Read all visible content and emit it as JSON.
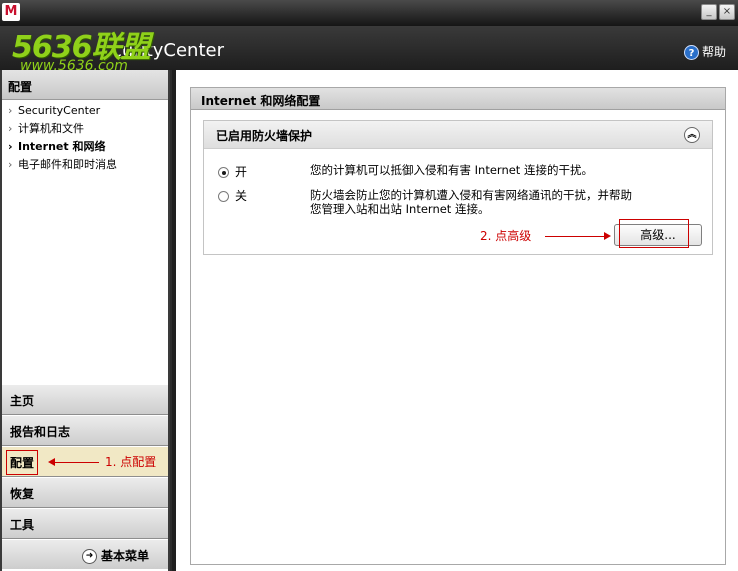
{
  "window": {
    "logo_letter": "M",
    "minimize": "_",
    "close": "×"
  },
  "header": {
    "watermark": "5636联盟",
    "watermark_url": "www.5636.com",
    "title_fragment": "curityCenter",
    "help_label": "帮助"
  },
  "sidebar": {
    "header": "配置",
    "items": [
      {
        "label": "SecurityCenter",
        "active": false
      },
      {
        "label": "计算机和文件",
        "active": false
      },
      {
        "label": "Internet 和网络",
        "active": true
      },
      {
        "label": "电子邮件和即时消息",
        "active": false
      }
    ],
    "tabs": [
      {
        "label": "主页"
      },
      {
        "label": "报告和日志"
      },
      {
        "label": "配置",
        "selected": true
      },
      {
        "label": "恢复"
      },
      {
        "label": "工具"
      }
    ],
    "basic_menu": "基本菜单",
    "annotation": "1. 点配置"
  },
  "main": {
    "frame_title": "Internet 和网络配置",
    "panel": {
      "title": "已启用防火墙保护",
      "options": [
        {
          "label": "开",
          "checked": true,
          "description": "您的计算机可以抵御入侵和有害 Internet 连接的干扰。"
        },
        {
          "label": "关",
          "checked": false,
          "description_line1": "防火墙会防止您的计算机遭入侵和有害网络通讯的干扰，并帮助",
          "description_line2": "您管理入站和出站 Internet 连接。"
        }
      ],
      "annotation": "2. 点高级",
      "advanced_button": "高级..."
    }
  },
  "colors": {
    "annotation_red": "#cc0000",
    "watermark_green": "#8fd11a"
  }
}
